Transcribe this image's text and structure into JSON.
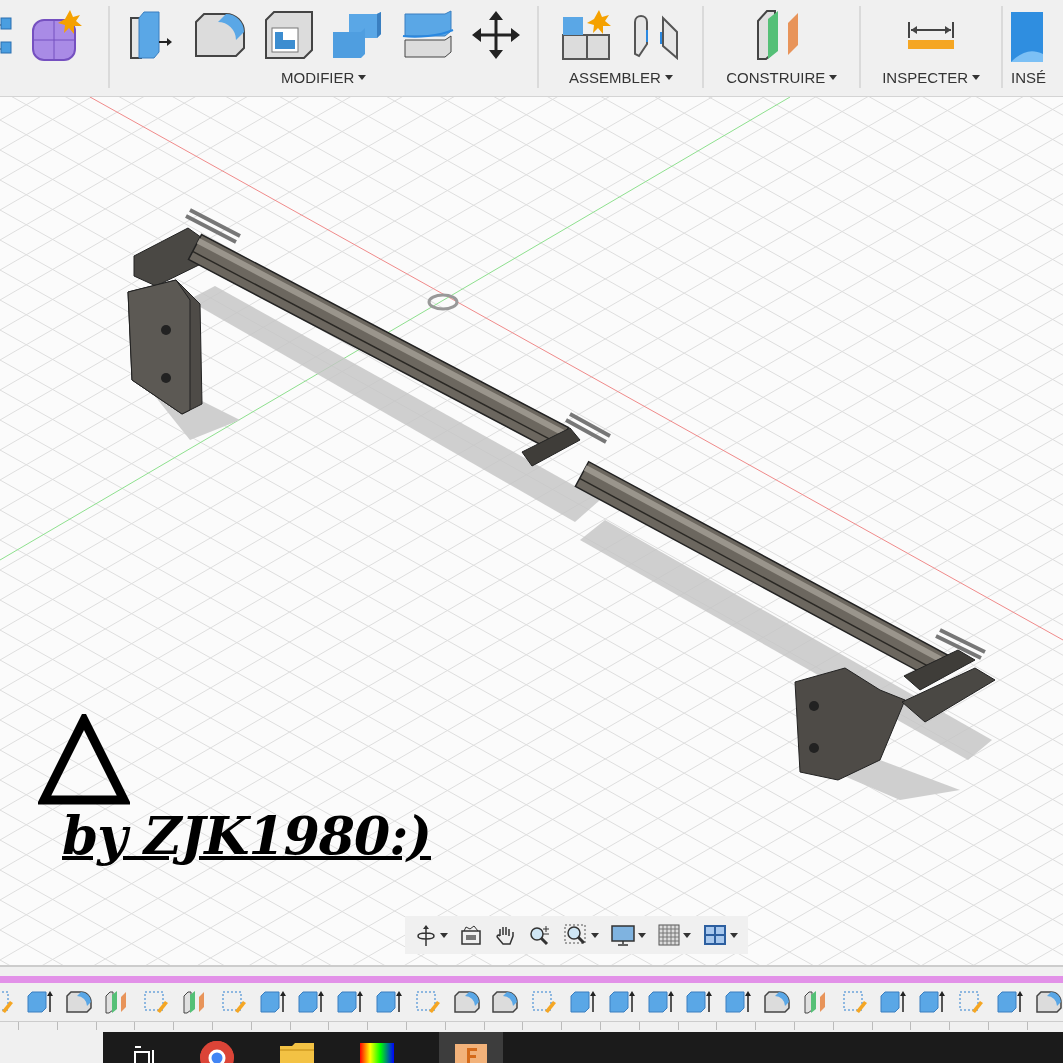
{
  "toolbar": {
    "groups": [
      {
        "label": "MODIFIER",
        "dropdown": true
      },
      {
        "label": "ASSEMBLER",
        "dropdown": true
      },
      {
        "label": "CONSTRUIRE",
        "dropdown": true
      },
      {
        "label": "INSPECTER",
        "dropdown": true
      },
      {
        "label": "INSÉ",
        "dropdown": false
      }
    ]
  },
  "annotation": {
    "text": "by ZJK1980:)"
  },
  "timeline": [
    {
      "kind": "sketch"
    },
    {
      "kind": "extrude"
    },
    {
      "kind": "fillet"
    },
    {
      "kind": "plane"
    },
    {
      "kind": "sketch"
    },
    {
      "kind": "plane"
    },
    {
      "kind": "sketch"
    },
    {
      "kind": "extrude"
    },
    {
      "kind": "extrude"
    },
    {
      "kind": "extrude"
    },
    {
      "kind": "extrude"
    },
    {
      "kind": "sketch"
    },
    {
      "kind": "fillet"
    },
    {
      "kind": "fillet"
    },
    {
      "kind": "sketch"
    },
    {
      "kind": "extrude"
    },
    {
      "kind": "extrude"
    },
    {
      "kind": "extrude"
    },
    {
      "kind": "extrude"
    },
    {
      "kind": "extrude"
    },
    {
      "kind": "fillet"
    },
    {
      "kind": "plane"
    },
    {
      "kind": "sketch"
    },
    {
      "kind": "extrude"
    },
    {
      "kind": "extrude"
    },
    {
      "kind": "sketch"
    },
    {
      "kind": "extrude"
    },
    {
      "kind": "fillet"
    }
  ]
}
